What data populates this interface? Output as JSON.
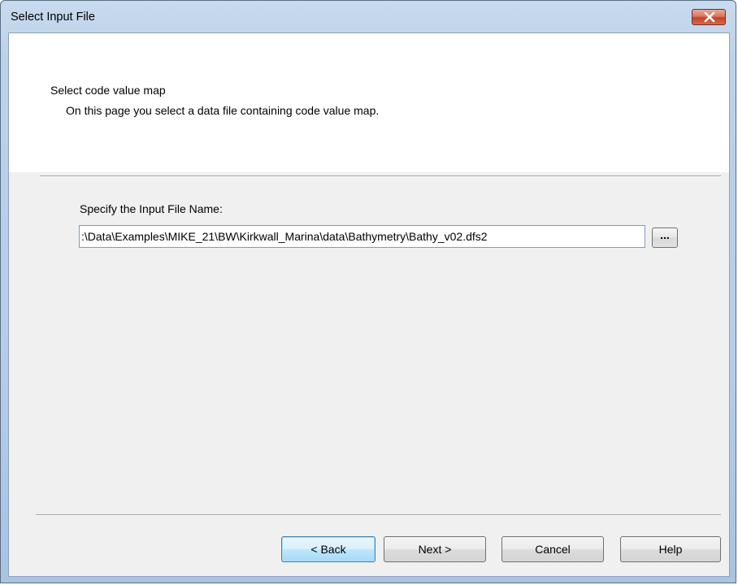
{
  "window": {
    "title": "Select Input File",
    "close_icon": "close-icon"
  },
  "header": {
    "heading": "Select code value map",
    "description": "On this page you select a data file containing code value map."
  },
  "form": {
    "field_label": "Specify the Input File Name:",
    "file_path": ":\\Data\\Examples\\MIKE_21\\BW\\Kirkwall_Marina\\data\\Bathymetry\\Bathy_v02.dfs2",
    "browse_label": "..."
  },
  "buttons": {
    "back": "< Back",
    "next": "Next >",
    "cancel": "Cancel",
    "help": "Help"
  },
  "colors": {
    "title_bar": "#bcd2ea",
    "close_button": "#c5432a",
    "dialog_body": "#f0f0f0",
    "default_button_border": "#3c7fb1"
  }
}
